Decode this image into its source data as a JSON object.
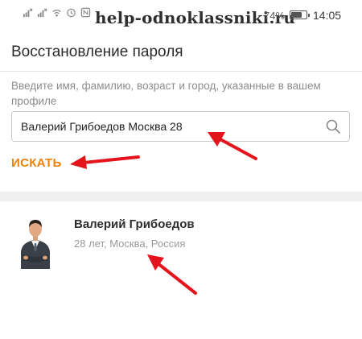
{
  "status_bar": {
    "watermark": "help-odnoklassniki.ru",
    "battery_percent_label": "74%",
    "battery_level": 0.74,
    "time": "14:05",
    "icons": [
      "signal-icon",
      "wifi-icon",
      "alarm-icon",
      "nfc-icon"
    ]
  },
  "header": {
    "title": "Восстановление пароля"
  },
  "form": {
    "hint": "Введите имя, фамилию, возраст и город, указанные в вашем профиле",
    "search_value": "Валерий Грибоедов Москва 28",
    "search_button_label": "ИСКАТЬ"
  },
  "result": {
    "name": "Валерий Грибоедов",
    "meta": "28 лет, Москва, Россия"
  },
  "colors": {
    "accent": "#ee8208",
    "annotation_arrow": "#e3141b"
  }
}
